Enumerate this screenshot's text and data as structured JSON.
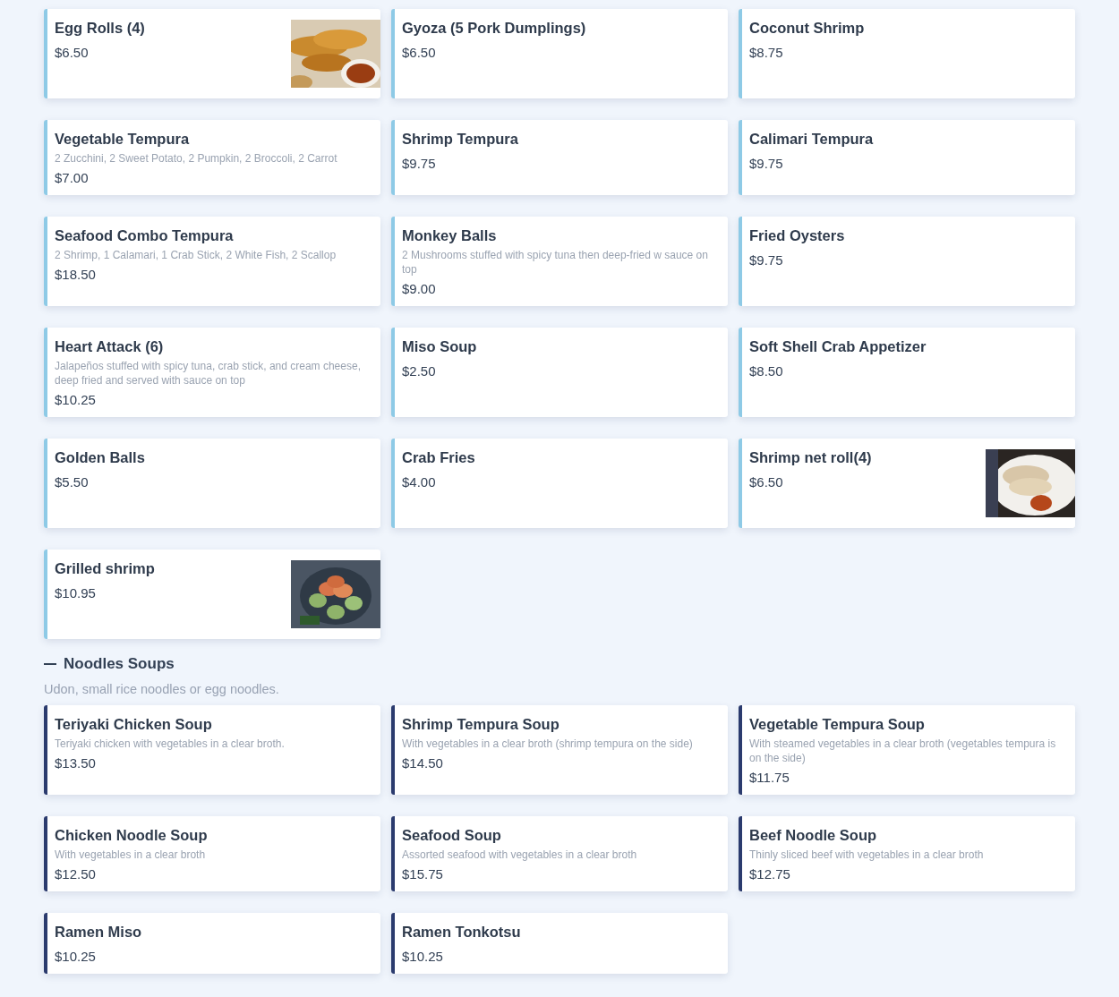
{
  "sections": [
    {
      "color": "#8ecae6",
      "items": [
        {
          "name": "Egg Rolls (4)",
          "price": "$6.50"
        },
        {
          "name": "Gyoza (5 Pork Dumplings)",
          "price": "$6.50"
        },
        {
          "name": "Coconut Shrimp",
          "price": "$8.75"
        },
        {
          "name": "Vegetable Tempura",
          "description": "2 Zucchini, 2 Sweet Potato, 2 Pumpkin, 2 Broccoli, 2 Carrot",
          "price": "$7.00"
        },
        {
          "name": "Shrimp Tempura",
          "price": "$9.75"
        },
        {
          "name": "Calimari Tempura",
          "price": "$9.75"
        },
        {
          "name": "Seafood Combo Tempura",
          "description": "2 Shrimp, 1 Calamari, 1 Crab Stick, 2 White Fish, 2 Scallop",
          "price": "$18.50"
        },
        {
          "name": "Monkey Balls",
          "description": "2 Mushrooms stuffed with spicy tuna then deep-fried w sauce on top",
          "price": "$9.00"
        },
        {
          "name": "Fried Oysters",
          "price": "$9.75"
        },
        {
          "name": "Heart Attack (6)",
          "description": "Jalapeños stuffed with spicy tuna, crab stick, and cream cheese, deep fried and served with sauce on top",
          "price": "$10.25"
        },
        {
          "name": "Miso Soup",
          "price": "$2.50"
        },
        {
          "name": "Soft Shell Crab Appetizer",
          "price": "$8.50"
        },
        {
          "name": "Golden Balls",
          "price": "$5.50"
        },
        {
          "name": "Crab Fries",
          "price": "$4.00"
        },
        {
          "name": "Shrimp net roll(4)",
          "price": "$6.50"
        },
        {
          "name": "Grilled shrimp",
          "price": "$10.95"
        }
      ]
    },
    {
      "title": "Noodles Soups",
      "expanded": true,
      "description": "Udon, small rice noodles or egg noodles.",
      "color": "#2b3b6e",
      "items": [
        {
          "name": "Teriyaki Chicken Soup",
          "description": "Teriyaki chicken with vegetables in a clear broth.",
          "price": "$13.50"
        },
        {
          "name": "Shrimp Tempura Soup",
          "description": "With vegetables in a clear broth (shrimp tempura on the side)",
          "price": "$14.50"
        },
        {
          "name": "Vegetable Tempura Soup",
          "description": "With steamed vegetables in a clear broth (vegetables tempura is on the side)",
          "price": "$11.75"
        },
        {
          "name": "Chicken Noodle Soup",
          "description": "With vegetables in a clear broth",
          "price": "$12.50"
        },
        {
          "name": "Seafood Soup",
          "description": "Assorted seafood with vegetables in a clear broth",
          "price": "$15.75"
        },
        {
          "name": "Beef Noodle Soup",
          "description": "Thinly sliced beef with vegetables in a clear broth",
          "price": "$12.75"
        },
        {
          "name": "Ramen Miso",
          "price": "$10.25"
        },
        {
          "name": "Ramen Tonkotsu",
          "price": "$10.25"
        }
      ]
    }
  ]
}
